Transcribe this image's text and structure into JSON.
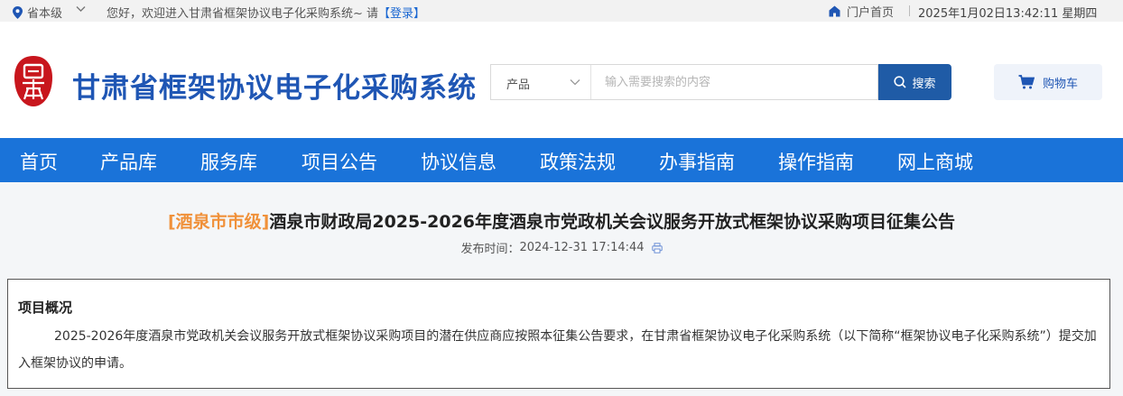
{
  "topbar": {
    "location": "省本级",
    "welcome": "您好，欢迎进入甘肃省框架协议电子化采购系统~ 请",
    "login": "【登录】",
    "portal": "门户首页",
    "datetime": "2025年1月02日13:42:11 星期四"
  },
  "header": {
    "logo_text": "甘肃",
    "site_title": "甘肃省框架协议电子化采购系统",
    "search_category": "产品",
    "search_placeholder": "输入需要搜索的内容",
    "search_button": "搜索",
    "cart_button": "购物车"
  },
  "nav": {
    "items": [
      "首页",
      "产品库",
      "服务库",
      "项目公告",
      "协议信息",
      "政策法规",
      "办事指南",
      "操作指南",
      "网上商城"
    ]
  },
  "article": {
    "tag": "[酒泉市市级]",
    "title": "酒泉市财政局2025-2026年度酒泉市党政机关会议服务开放式框架协议采购项目征集公告",
    "pub_label": "发布时间：",
    "pub_time": "2024-12-31 17:14:44",
    "section_heading": "项目概况",
    "paragraph": "2025-2026年度酒泉市党政机关会议服务开放式框架协议采购项目的潜在供应商应按照本征集公告要求，在甘肃省框架协议电子化采购系统（以下简称“框架协议电子化采购系统”）提交加入框架协议的申请。"
  },
  "colors": {
    "brand_blue": "#1f56b4",
    "nav_blue": "#1a73d9",
    "tag_orange": "#f0913a",
    "logo_red": "#c8161d"
  }
}
